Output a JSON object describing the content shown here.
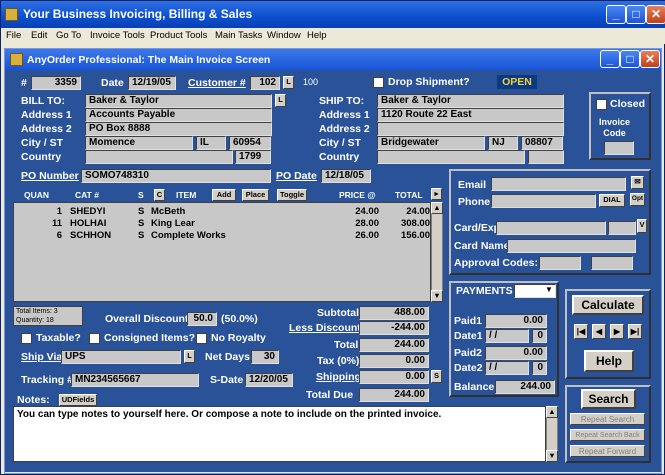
{
  "app_title": "Your Business Invoicing, Billing & Sales",
  "menu": [
    "File",
    "Edit",
    "Go To",
    "Invoice Tools",
    "Product Tools",
    "Main Tasks",
    "Window",
    "Help"
  ],
  "window_title": "AnyOrder Professional: The Main Invoice Screen",
  "invoice": {
    "hash_label": "#",
    "number": "3359",
    "date_label": "Date",
    "date": "12/19/05",
    "customer_label": "Customer #",
    "customer_no": "102",
    "l": "L",
    "count": "100",
    "drop_ship_label": "Drop Shipment?",
    "status": "OPEN"
  },
  "bill_to": {
    "label": "BILL TO:",
    "l": "L",
    "name": "Baker & Taylor",
    "addr1_label": "Address 1",
    "addr1": "Accounts Payable",
    "addr2_label": "Address 2",
    "addr2": "PO Box 8888",
    "city_label": "City / ST",
    "city": "Momence",
    "state": "IL",
    "zip": "60954",
    "country_label": "Country",
    "country": "",
    "code": "1799"
  },
  "ship_to": {
    "label": "SHIP TO:",
    "name": "Baker & Taylor",
    "addr1_label": "Address 1",
    "addr1": "1120 Route 22 East",
    "addr2_label": "Address 2",
    "addr2": "",
    "city_label": "City / ST",
    "city": "Bridgewater",
    "state": "NJ",
    "zip": "08807",
    "country_label": "Country",
    "country": ""
  },
  "closed": {
    "label": "Closed",
    "invoice_code_label": "Invoice\nCode"
  },
  "po": {
    "number_label": "PO Number",
    "number": "SOMO748310",
    "date_label": "PO Date",
    "date": "12/18/05"
  },
  "contact": {
    "email_label": "Email",
    "phone_label": "Phone",
    "dial": "DIAL",
    "opt": "Opt",
    "cardexp_label": "Card/Exp",
    "cardname_label": "Card Name",
    "approval_label": "Approval Codes:",
    "v": "V"
  },
  "columns": {
    "quan": "QUAN",
    "cat": "CAT #",
    "s": "S",
    "c": "C",
    "item": "ITEM",
    "add": "Add",
    "place": "Place",
    "toggle": "Toggle",
    "price": "PRICE @",
    "total": "TOTAL"
  },
  "items": [
    {
      "quan": "1",
      "cat": "SHEDYI",
      "s": "S",
      "item": "McBeth",
      "price": "24.00",
      "total": "24.00"
    },
    {
      "quan": "11",
      "cat": "HOLHAI",
      "s": "S",
      "item": "King Lear",
      "price": "28.00",
      "total": "308.00"
    },
    {
      "quan": "6",
      "cat": "SCHHON",
      "s": "S",
      "item": "Complete Works",
      "price": "26.00",
      "total": "156.00"
    }
  ],
  "summary": {
    "total_items": "Total Items: 3",
    "quantity": "Quantity: 18",
    "overall_discount_label": "Overall Discount",
    "overall_discount": "50.0",
    "overall_pct": "(50.0%)",
    "taxable": "Taxable?",
    "consigned": "Consigned Items?",
    "no_royalty": "No Royalty",
    "ship_via_label": "Ship Via",
    "ship_via": "UPS",
    "l": "L",
    "net_days_label": "Net Days",
    "net_days": "30",
    "tracking_label": "Tracking #",
    "tracking": "MN234565667",
    "sdate_label": "S-Date",
    "sdate": "12/20/05",
    "notes_label": "Notes:",
    "udfields": "UDFields"
  },
  "totals": {
    "subtotal_label": "Subtotal",
    "subtotal": "488.00",
    "less_discount_label": "Less Discount",
    "less_discount": "-244.00",
    "total_label": "Total",
    "total": "244.00",
    "tax_label": "Tax (0%)",
    "tax": "0.00",
    "shipping_label": "Shipping",
    "shipping": "0.00",
    "s": "S",
    "total_due_label": "Total Due",
    "total_due": "244.00"
  },
  "payments": {
    "label": "PAYMENTS",
    "paid1_label": "Paid1",
    "paid1": "0.00",
    "date1_label": "Date1",
    "date1": " / / ",
    "date1_n": "0",
    "paid2_label": "Paid2",
    "paid2": "0.00",
    "date2_label": "Date2",
    "date2": " / / ",
    "date2_n": "0",
    "balance_label": "Balance",
    "balance": "244.00"
  },
  "actions": {
    "calculate": "Calculate",
    "help": "Help",
    "search": "Search",
    "repeat_search": "Repeat Search",
    "repeat_back": "Repeat Search Back",
    "repeat_forward": "Repeat Forward"
  },
  "notes_text": "You can type notes to yourself here.  Or compose a note to include on the printed invoice."
}
